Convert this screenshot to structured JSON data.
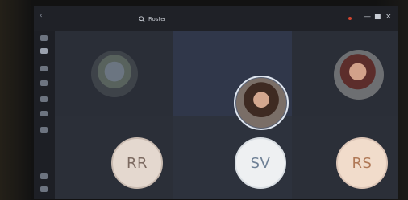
{
  "window": {
    "search_label": "Roster",
    "controls": [
      "minimize",
      "restore",
      "close"
    ]
  },
  "participants": [
    {
      "type": "photo"
    },
    {
      "type": "photo"
    },
    {
      "type": "photo"
    },
    {
      "type": "initials",
      "initials": "RR"
    },
    {
      "type": "initials",
      "initials": "SV"
    },
    {
      "type": "initials",
      "initials": "RS"
    }
  ],
  "icons": [
    "search-icon",
    "minimize-icon",
    "restore-icon",
    "close-icon"
  ]
}
